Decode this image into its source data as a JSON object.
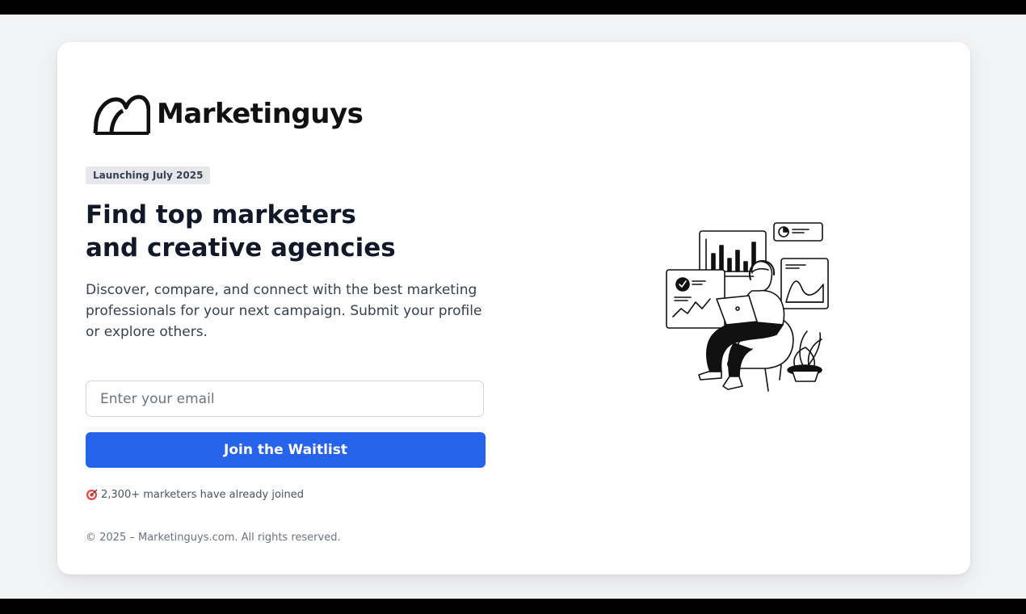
{
  "brand": {
    "name": "Marketinguys",
    "logo_icon": "double-arch-logo-icon"
  },
  "hero": {
    "badge": "Launching July 2025",
    "headline_line1": "Find top marketers",
    "headline_line2": "and creative agencies",
    "description": "Discover, compare, and connect with the best marketing professionals for your next campaign. Submit your profile or explore others."
  },
  "form": {
    "email_placeholder": "Enter your email",
    "email_value": "",
    "submit_label": "Join the Waitlist"
  },
  "social_proof": {
    "icon": "target-icon",
    "text": "2,300+ marketers have already joined"
  },
  "footer": {
    "copyright": "© 2025 – Marketinguys.com. All rights reserved."
  },
  "illustration": {
    "icon": "analytics-person-illustration"
  },
  "colors": {
    "accent": "#2563eb",
    "background": "#f2f3f5",
    "card": "#ffffff",
    "text": "#111827"
  }
}
